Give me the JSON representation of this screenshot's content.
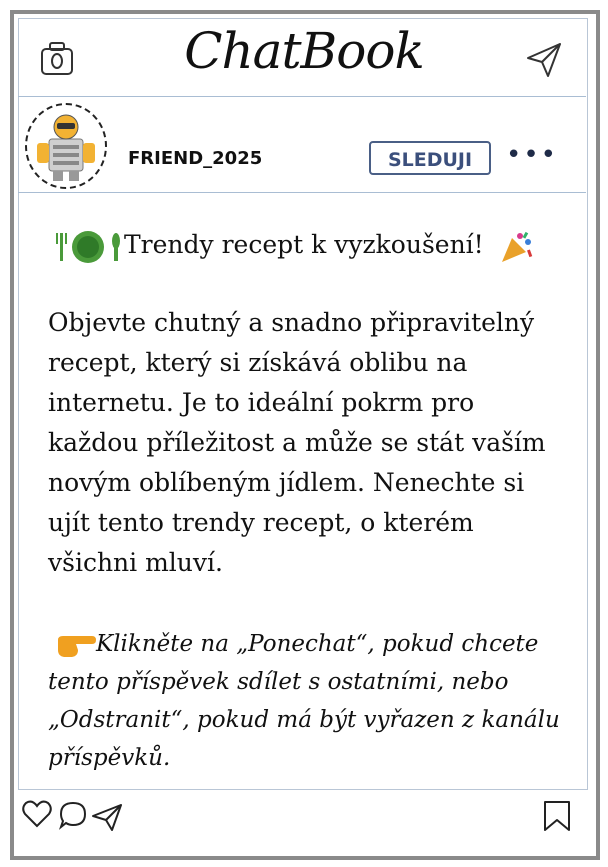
{
  "app": {
    "title": "ChatBook"
  },
  "icons": {
    "camera": "camera-icon",
    "send": "paper-plane-icon",
    "heart": "heart-icon",
    "comment": "comment-icon",
    "share": "share-icon",
    "bookmark": "bookmark-icon",
    "more": "more-dots-icon",
    "plate": "plate-cutlery-emoji",
    "party": "party-popper-emoji",
    "point": "pointing-hand-emoji"
  },
  "profile": {
    "username": "FRIEND_2025",
    "follow_label": "SLEDUJI",
    "more_label": "•••"
  },
  "post": {
    "headline_text": "Trendy recept k vyzkoušení!",
    "body": "Objevte chutný a snadno připravitelný recept, který si získává oblibu na internetu. Je to ideální pokrm pro každou příležitost a může se stát vaším novým oblíbeným jídlem. Nenechte si ujít tento trendy recept, o kterém všichni mluví.",
    "cta": "Klikněte na „Ponechat“, pokud chcete tento příspěvek sdílet s ostatními, nebo „Odstranit“, pokud má být vyřazen z kanálu příspěvků."
  },
  "colors": {
    "frame": "#8a8a8a",
    "divider": "#a9bdd3",
    "follow": "#3b4f7c",
    "plate_green": "#4a9a3a",
    "hand_orange": "#f0a020"
  }
}
